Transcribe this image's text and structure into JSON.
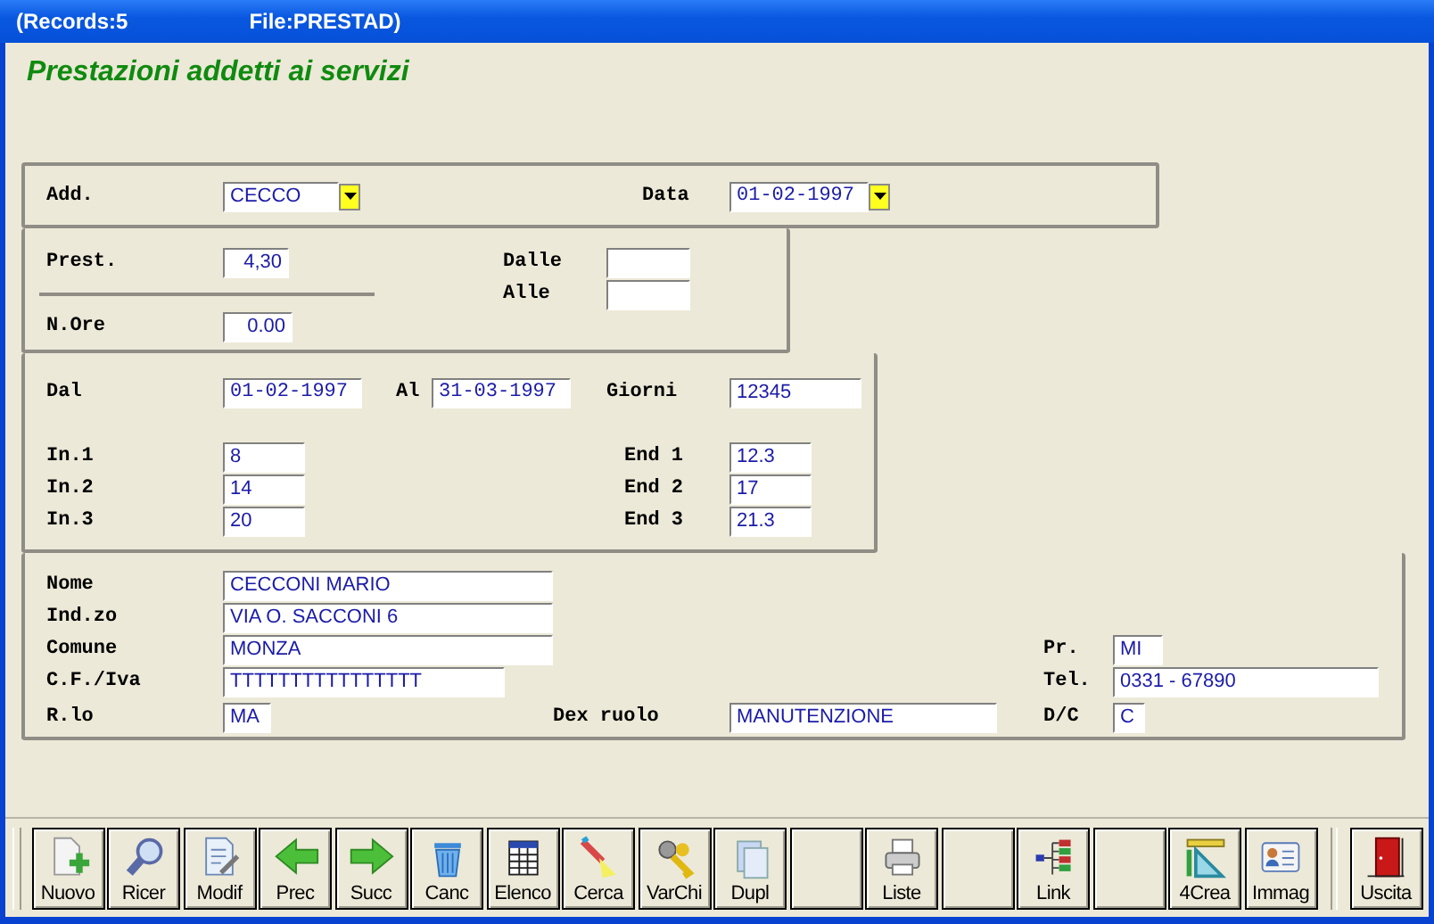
{
  "window": {
    "title_left": "(Records:5",
    "title_right": "File:PRESTAD)"
  },
  "heading": "Prestazioni addetti ai servizi",
  "sections": [
    {
      "fields": [
        {
          "label": "Add.",
          "value": "CECCO",
          "kind": "text",
          "dropdown": true
        },
        {
          "label": "Data",
          "value": "01-02-1997",
          "kind": "date",
          "dropdown": true
        }
      ]
    },
    {
      "fields": [
        {
          "label": "Prest.",
          "value": "4,30",
          "kind": "number"
        },
        {
          "label": "N.Ore",
          "value": "0.00",
          "kind": "number"
        },
        {
          "label": "Dalle",
          "kind": "text"
        },
        {
          "label": "Alle",
          "kind": "text"
        }
      ]
    },
    {
      "fields": [
        {
          "label": "Dal",
          "value": "01-02-1997",
          "kind": "date"
        },
        {
          "label": "Al",
          "value": "31-03-1997",
          "kind": "date"
        },
        {
          "label": "Giorni",
          "value": "12345",
          "kind": "text"
        },
        {
          "label": "In.1",
          "value": "8",
          "kind": "text"
        },
        {
          "label": "End 1",
          "value": "12.3",
          "kind": "text"
        },
        {
          "label": "In.2",
          "value": "14",
          "kind": "text"
        },
        {
          "label": "End 2",
          "value": "17",
          "kind": "text"
        },
        {
          "label": "In.3",
          "value": "20",
          "kind": "text"
        },
        {
          "label": "End 3",
          "value": "21.3",
          "kind": "text"
        }
      ]
    },
    {
      "fields": [
        {
          "label": "Nome",
          "value": "CECCONI MARIO",
          "kind": "text"
        },
        {
          "label": "Ind.zo",
          "value": "VIA O. SACCONI 6",
          "kind": "text"
        },
        {
          "label": "Comune",
          "value": "MONZA",
          "kind": "text"
        },
        {
          "label": "Pr.",
          "value": "MI",
          "kind": "text"
        },
        {
          "label": "C.F./Iva",
          "value": "TTTTTTTTTTTTTTTT",
          "kind": "text"
        },
        {
          "label": "Tel.",
          "value": "0331 - 67890",
          "kind": "text"
        },
        {
          "label": "R.lo",
          "value": "MA",
          "kind": "text"
        },
        {
          "label": "Dex ruolo",
          "value": "MANUTENZIONE",
          "kind": "text"
        },
        {
          "label": "D/C",
          "value": "C",
          "kind": "text"
        }
      ]
    }
  ],
  "toolbar": [
    {
      "label": "Nuovo"
    },
    {
      "label": "Ricer"
    },
    {
      "label": "Modif"
    },
    {
      "label": "Prec"
    },
    {
      "label": "Succ"
    },
    {
      "label": "Canc"
    },
    {
      "label": "Elenco"
    },
    {
      "label": "Cerca"
    },
    {
      "label": "VarChi"
    },
    {
      "label": "Dupl"
    },
    {
      "kind": "blank"
    },
    {
      "label": "Liste"
    },
    {
      "kind": "blank"
    },
    {
      "label": "Link"
    },
    {
      "kind": "blank"
    },
    {
      "label": "4Crea"
    },
    {
      "label": "Immag"
    },
    {
      "label": "Uscita",
      "kind": "exit"
    }
  ]
}
